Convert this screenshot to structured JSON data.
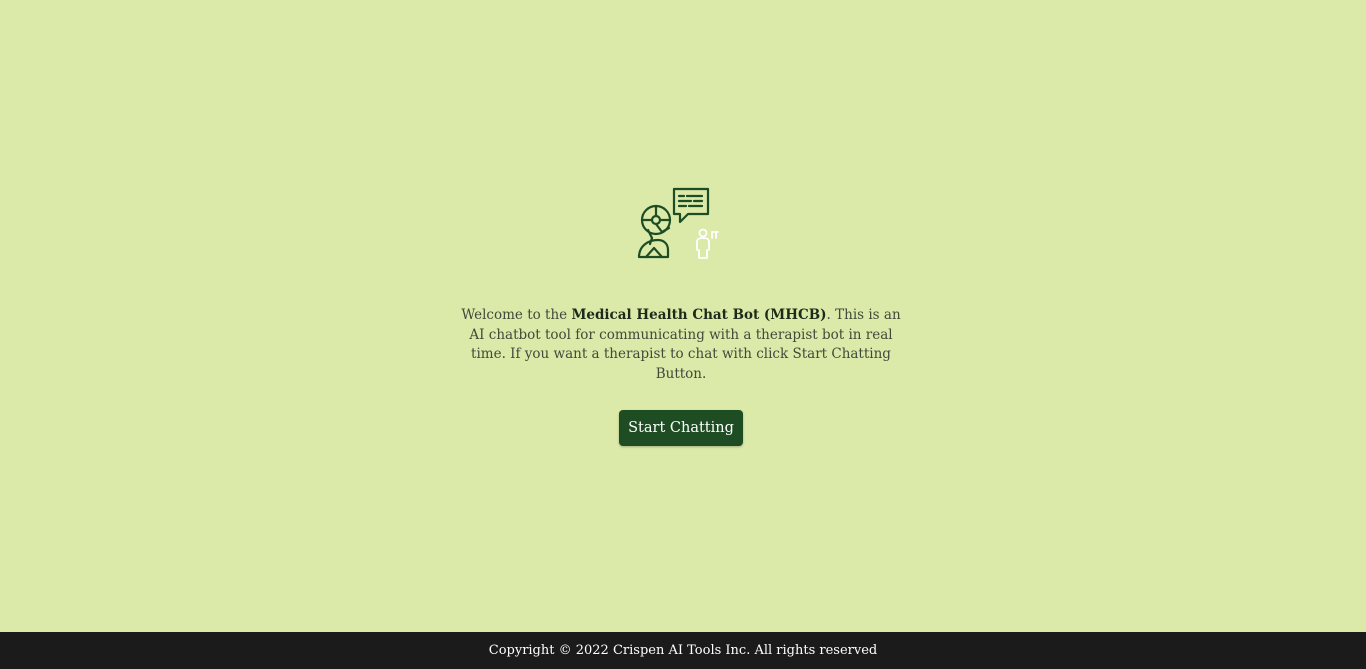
{
  "welcome": {
    "prefix": "Welcome to the ",
    "app_name": "Medical Health Chat Bot (MHCB)",
    "suffix": ". This is an AI chatbot tool for communicating with a therapist bot in real time. If you want a therapist to chat with click Start Chatting Button."
  },
  "logo": {
    "icon": "ai-therapist-chat-icon",
    "color": "#1e4d24"
  },
  "start_button": {
    "label": "Start Chatting",
    "color": "#1e4d24"
  },
  "footer": {
    "copyright": "Copyright © 2022 Crispen AI Tools Inc. All rights reserved"
  },
  "colors": {
    "background": "#dbe9a9",
    "footer_background": "#1b1b1b"
  }
}
